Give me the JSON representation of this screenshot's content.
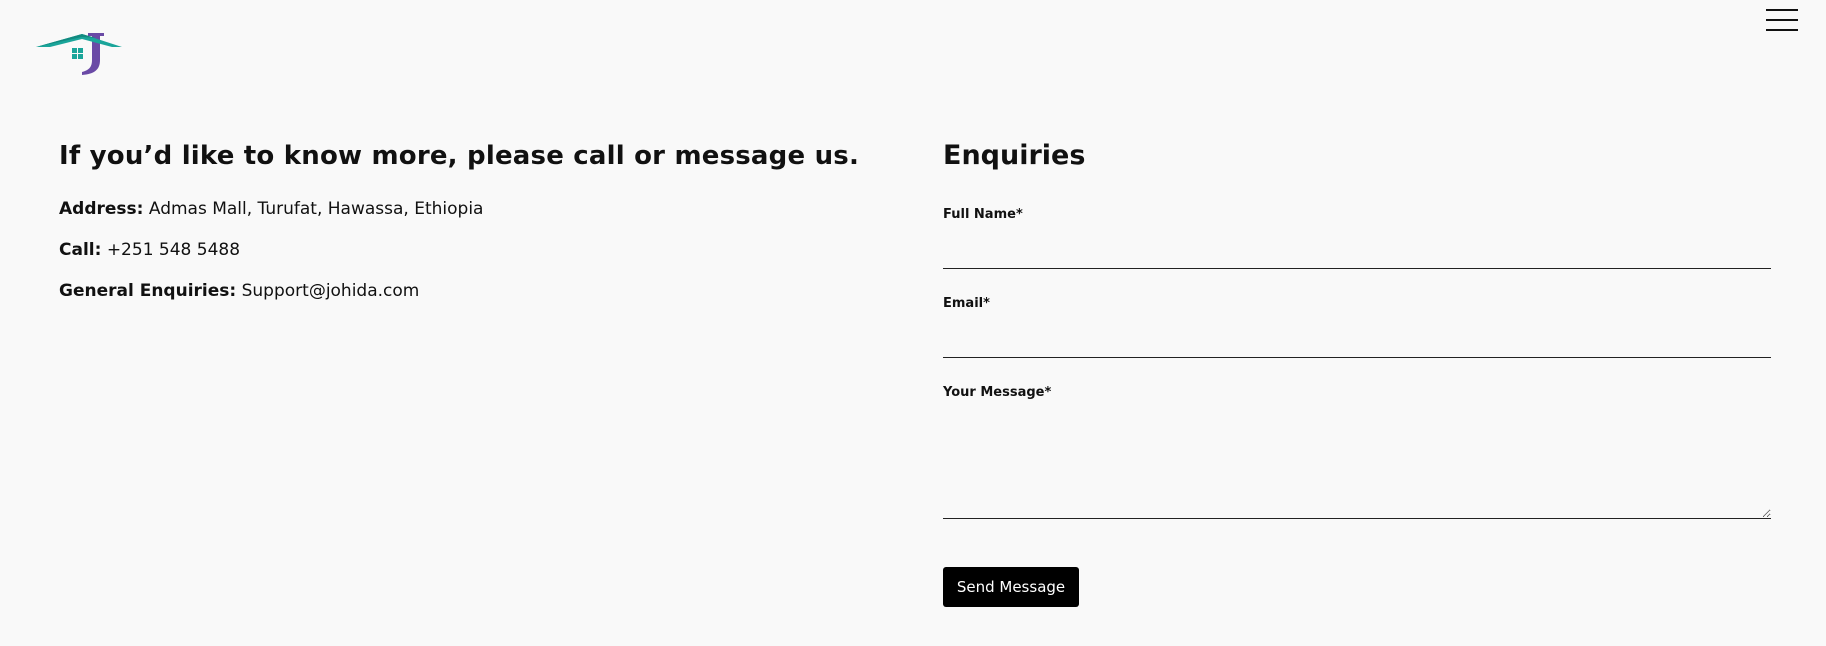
{
  "header": {
    "logo_icon": "johida-house-j-logo",
    "menu_icon": "hamburger-menu-icon",
    "colors": {
      "roof": "#1aa59a",
      "letter_j": "#6a4aa6"
    }
  },
  "contact": {
    "heading": "If you’d like to know more, please call or message us.",
    "address_label": "Address:",
    "address_value": "Admas Mall, Turufat, Hawassa, Ethiopia",
    "call_label": "Call:",
    "call_value": "+251 548 5488",
    "general_label": "General Enquiries:",
    "general_value": "Support@johida.com"
  },
  "form": {
    "heading": "Enquiries",
    "full_name_label": "Full Name*",
    "full_name_value": "",
    "email_label": "Email*",
    "email_value": "",
    "message_label": "Your Message*",
    "message_value": "",
    "submit_label": "Send Message"
  }
}
